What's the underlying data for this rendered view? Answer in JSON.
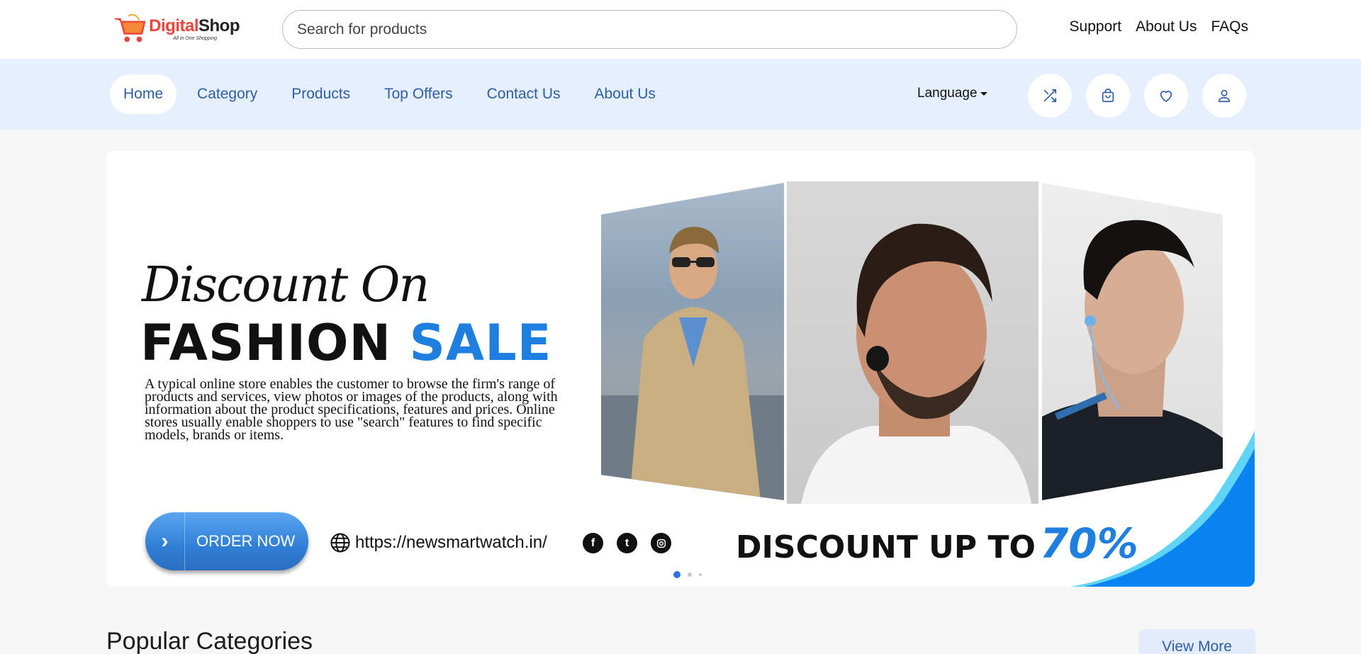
{
  "header": {
    "logo": {
      "brand_part1": "Digital",
      "brand_part2": "Shop",
      "tagline": "All in One Shopping"
    },
    "search": {
      "placeholder": "Search for products",
      "value": ""
    },
    "links": [
      "Support",
      "About Us",
      "FAQs"
    ]
  },
  "nav": {
    "items": [
      {
        "label": "Home",
        "active": true
      },
      {
        "label": "Category",
        "active": false
      },
      {
        "label": "Products",
        "active": false
      },
      {
        "label": "Top Offers",
        "active": false
      },
      {
        "label": "Contact Us",
        "active": false
      },
      {
        "label": "About Us",
        "active": false
      }
    ],
    "language_label": "Language",
    "icons": [
      "shuffle-icon",
      "shopping-bag-icon",
      "heart-icon",
      "user-icon"
    ]
  },
  "banner": {
    "script_text": "Discount On",
    "headline_part1": "FASHION",
    "headline_part2": "SALE",
    "description": "A typical online store enables the customer to browse the firm's range of products and services, view photos or images of the products, along with information about the product specifications, features and prices. Online stores usually enable shoppers to use \"search\" features to find specific models, brands or items.",
    "order_button": "ORDER NOW",
    "url": "https://newsmartwatch.in/",
    "social_icons": [
      "facebook-icon",
      "twitter-icon",
      "instagram-icon"
    ],
    "discount_text": "DISCOUNT UP TO",
    "discount_value": "70%",
    "colors": {
      "accent": "#1e7fe0",
      "curve": "#0a84f0"
    },
    "slides": 3,
    "active_slide": 1
  },
  "popular": {
    "title": "Popular Categories",
    "view_more": "View More"
  }
}
